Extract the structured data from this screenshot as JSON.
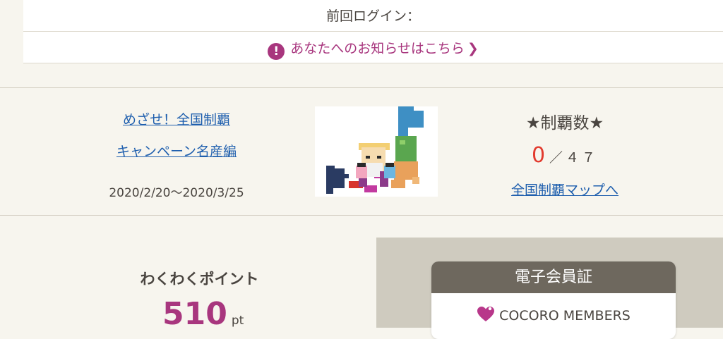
{
  "header": {
    "last_login_label": "前回ログイン：",
    "notice_text": "あなたへのお知らせはこちら",
    "notice_icon": "!",
    "notice_chevron": "❯"
  },
  "campaign": {
    "title_line1": "めざせ！全国制覇",
    "title_line2": "キャンペーン名産編",
    "period": "2020/2/20〜2020/3/25"
  },
  "seiha": {
    "title": "★制覇数★",
    "count": "0",
    "total": "／４７",
    "map_link": "全国制覇マップへ"
  },
  "points": {
    "label": "わくわくポイント",
    "value": "510",
    "unit": "pt"
  },
  "member_card": {
    "title": "電子会員証",
    "brand": "COCORO MEMBERS"
  },
  "colors": {
    "accent": "#a8367e",
    "link": "#1f5fae",
    "count": "#e23a2e",
    "card_header": "#6e685e"
  }
}
